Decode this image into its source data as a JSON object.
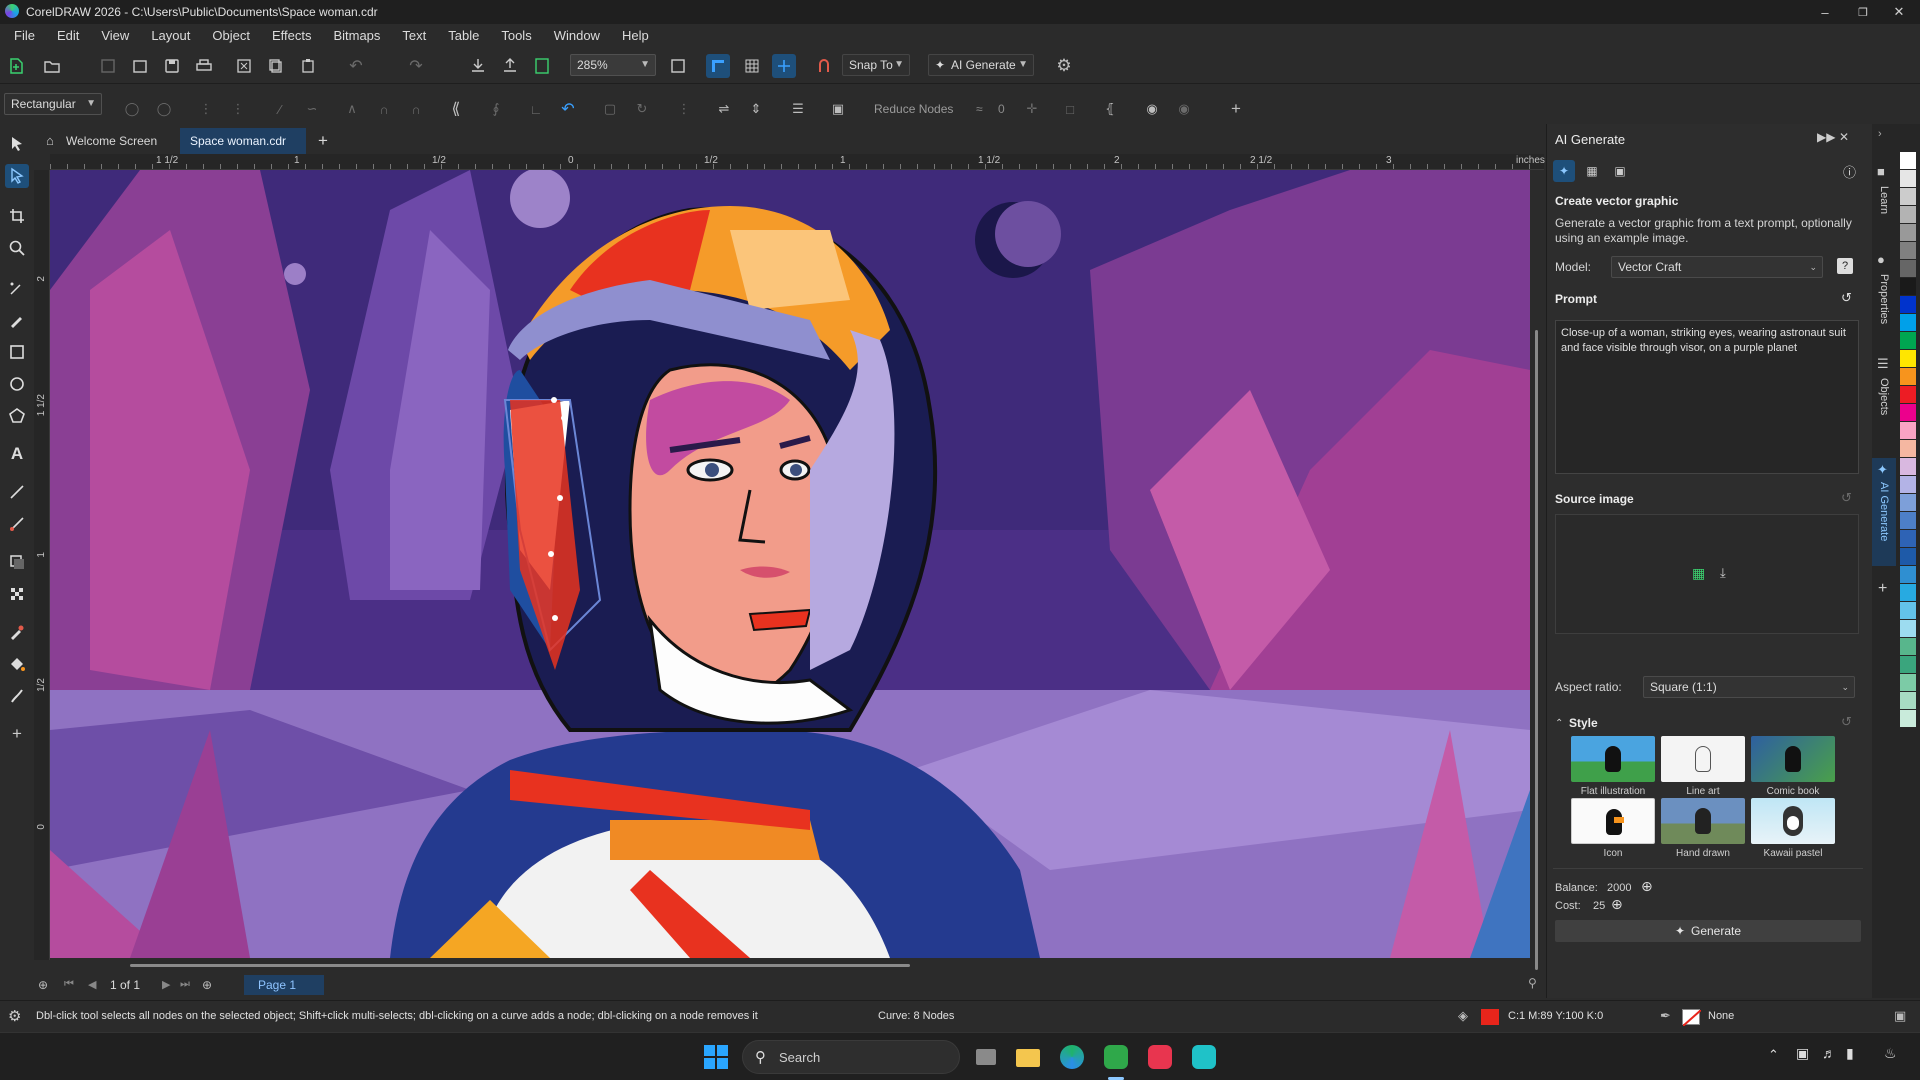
{
  "app": {
    "title": "CorelDRAW 2026 - C:\\Users\\Public\\Documents\\Space woman.cdr"
  },
  "menu": [
    "File",
    "Edit",
    "View",
    "Layout",
    "Object",
    "Effects",
    "Bitmaps",
    "Text",
    "Table",
    "Tools",
    "Window",
    "Help"
  ],
  "toolbar": {
    "zoom": "285%",
    "snap_to": "Snap To",
    "ai_generate": "AI Generate"
  },
  "property_bar": {
    "selection_mode": "Rectangular",
    "reduce_nodes": "Reduce Nodes",
    "smoothness_value": "0"
  },
  "tabs": [
    "Welcome Screen",
    "Space woman.cdr"
  ],
  "ruler": {
    "h_labels": [
      "1 1/2",
      "1",
      "1/2",
      "0",
      "1/2",
      "1",
      "1 1/2",
      "2",
      "2 1/2",
      "3"
    ],
    "units": "inches",
    "v_labels": [
      "2",
      "1 1/2",
      "1",
      "1/2",
      "0"
    ]
  },
  "page_nav": {
    "counter": "1 of 1",
    "page_tab": "Page 1"
  },
  "docker": {
    "title": "AI Generate",
    "section_title": "Create vector graphic",
    "description": "Generate a vector graphic from a text prompt, optionally using an example image.",
    "model_label": "Model:",
    "model_value": "Vector Craft",
    "prompt_label": "Prompt",
    "prompt_text": "Close-up of a woman, striking eyes, wearing astronaut suit and face visible through visor, on a purple planet",
    "source_label": "Source image",
    "aspect_label": "Aspect ratio:",
    "aspect_value": "Square (1:1)",
    "style_label": "Style",
    "styles": [
      "Flat illustration",
      "Line art",
      "Comic book",
      "Icon",
      "Hand drawn",
      "Kawaii pastel"
    ],
    "balance_label": "Balance:",
    "balance_value": "2000",
    "cost_label": "Cost:",
    "cost_value": "25",
    "generate_label": "Generate"
  },
  "side_tabs": [
    "Learn",
    "Properties",
    "Objects",
    "AI Generate"
  ],
  "status": {
    "hint": "Dbl-click tool selects all nodes on the selected object; Shift+click multi-selects; dbl-clicking on a curve adds a node; dbl-clicking on a node removes it",
    "curve_info": "Curve: 8 Nodes",
    "fill_info": "C:1 M:89 Y:100 K:0",
    "outline_info": "None"
  },
  "taskbar": {
    "search_placeholder": "Search"
  },
  "colors": {
    "accent": "#1e4f7a",
    "fill_swatch": "#e8251b",
    "palette": [
      "#ffffff",
      "#e6e6e6",
      "#cccccc",
      "#b3b3b3",
      "#999999",
      "#808080",
      "#666666",
      "#1a1a1a",
      "#0033cc",
      "#00a0e9",
      "#00a651",
      "#ffe600",
      "#f7941d",
      "#ed1c24",
      "#ec008c",
      "#f9a3c4",
      "#f5b7a1",
      "#d9b8e0",
      "#b3b3e6",
      "#7d9fd9",
      "#4d7fc8",
      "#2e63b5",
      "#1e5aa8",
      "#2f8fd1",
      "#27aae1",
      "#63c3ea",
      "#9ddcf0",
      "#58b68c",
      "#3aa57d",
      "#7ccba6",
      "#a7dcc3",
      "#c9ebdb"
    ]
  }
}
